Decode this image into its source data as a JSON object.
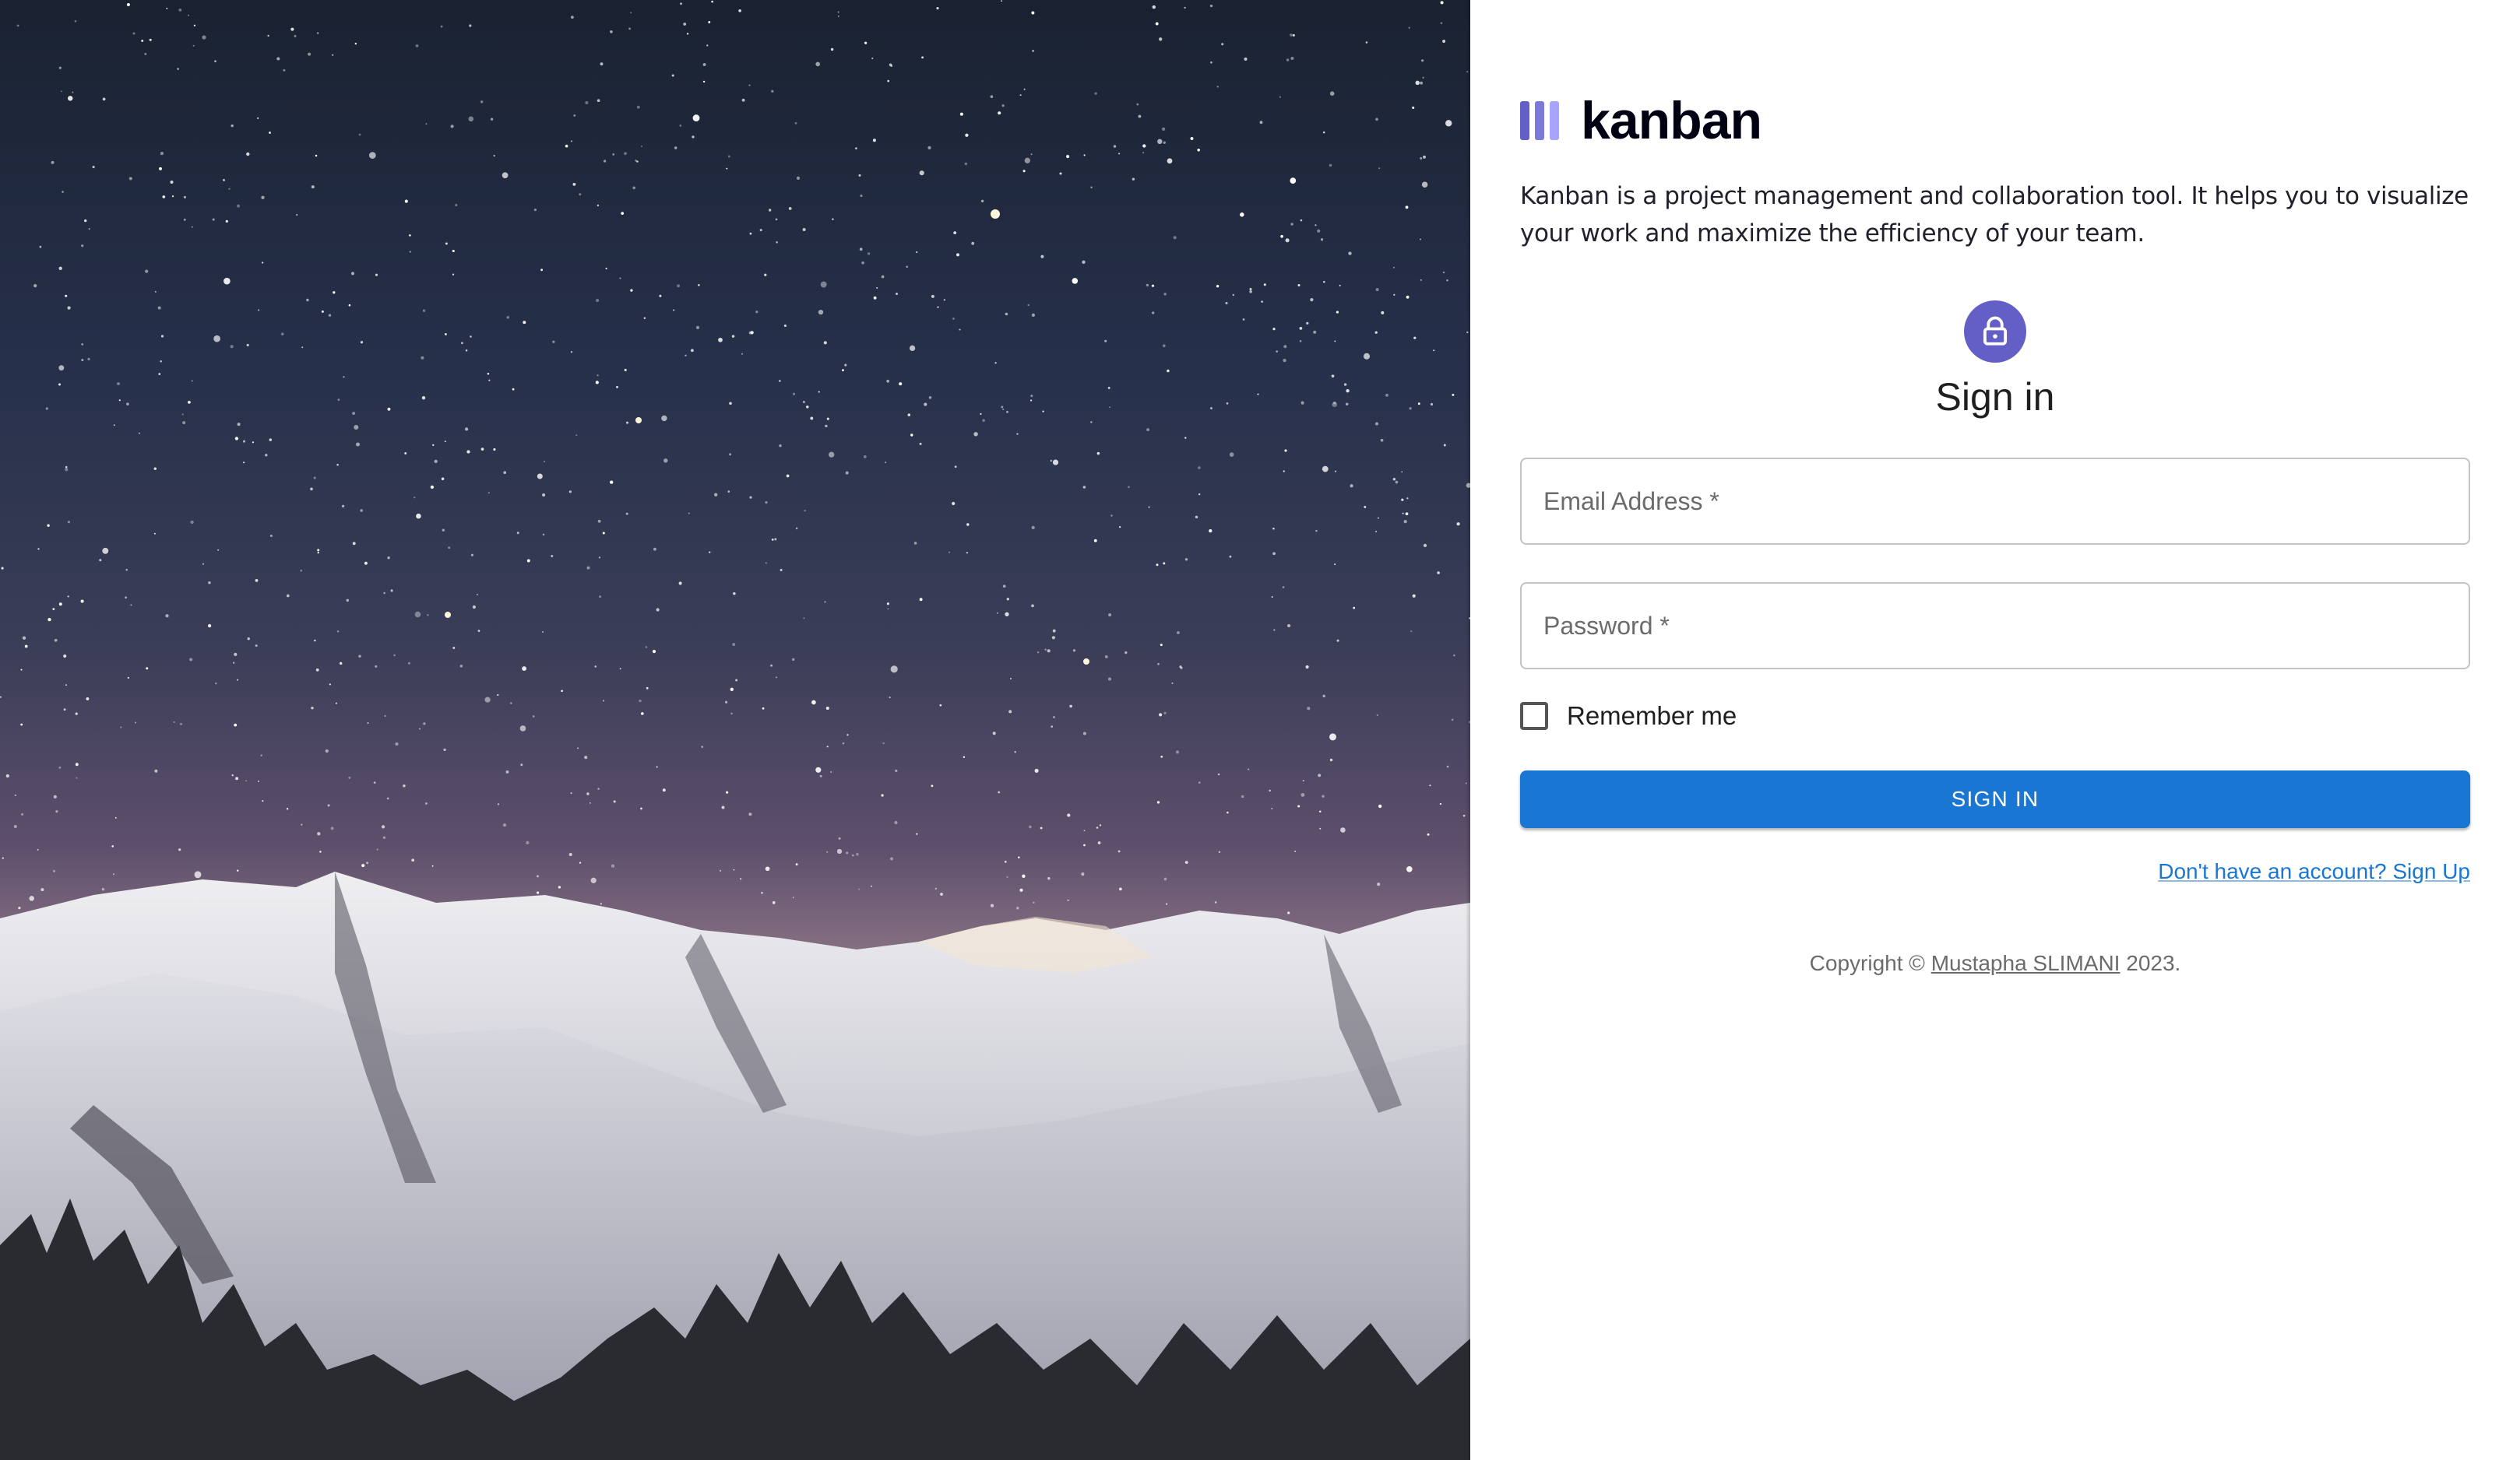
{
  "brand": {
    "name": "kanban",
    "logo_colors": [
      "#635fc7",
      "#7d79d8",
      "#a8a4ff"
    ]
  },
  "intro": {
    "text": "Kanban is a project management and collaboration tool. It helps you to visualize your work and maximize the efficiency of your team."
  },
  "signin": {
    "icon": "lock-icon",
    "title": "Sign in",
    "email_label": "Email Address *",
    "password_label": "Password *",
    "remember_label": "Remember me",
    "remember_checked": false,
    "button_label": "SIGN IN",
    "signup_link": "Don't have an account? Sign Up"
  },
  "footer": {
    "prefix": "Copyright © ",
    "author": "Mustapha SLIMANI",
    "suffix": " 2023."
  },
  "colors": {
    "accent": "#635fc7",
    "primary": "#1976d2"
  }
}
